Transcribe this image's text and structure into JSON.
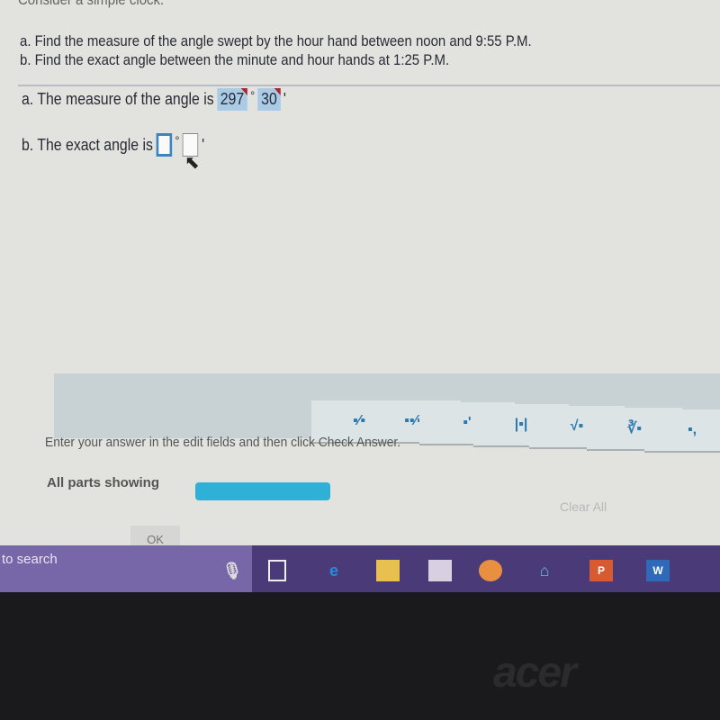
{
  "question": {
    "intro": "Consider a simple clock.",
    "a": "a. Find the measure of the angle swept by the hour hand between noon and 9:55 P.M.",
    "b": "b. Find the exact angle between the minute and hour hands at 1:25 P.M."
  },
  "answers": {
    "a_label": "a. The measure of the angle is",
    "a_degrees": "297",
    "a_minutes": "30",
    "degree_symbol": "°",
    "minute_symbol": "'",
    "b_label": "b. The exact angle is",
    "b_degrees": "",
    "b_minutes": ""
  },
  "toolbar": {
    "buttons": [
      {
        "icon": "fraction-icon",
        "glyph": "▪⁄▪"
      },
      {
        "icon": "mixed-number-icon",
        "glyph": "▪▪⁄▪"
      },
      {
        "icon": "exponent-icon",
        "glyph": "▪'"
      },
      {
        "icon": "absolute-value-icon",
        "glyph": "|▪|"
      },
      {
        "icon": "square-root-icon",
        "glyph": "√▪"
      },
      {
        "icon": "nth-root-icon",
        "glyph": "∛▪"
      },
      {
        "icon": "subscript-icon",
        "glyph": "▪,"
      }
    ]
  },
  "instructions": "Enter your answer in the edit fields and then click Check Answer.",
  "status": {
    "label": "All parts showing",
    "progress": 1.0,
    "color": "#2fb0d6"
  },
  "clear_all": "Clear All",
  "ok": "OK",
  "taskbar": {
    "search": "to search",
    "icons": [
      "microphone-icon",
      "task-view-icon",
      "edge-icon",
      "file-explorer-icon",
      "store-icon",
      "firefox-icon",
      "network-icon",
      "powerpoint-icon",
      "word-icon"
    ]
  },
  "brand": "acer"
}
